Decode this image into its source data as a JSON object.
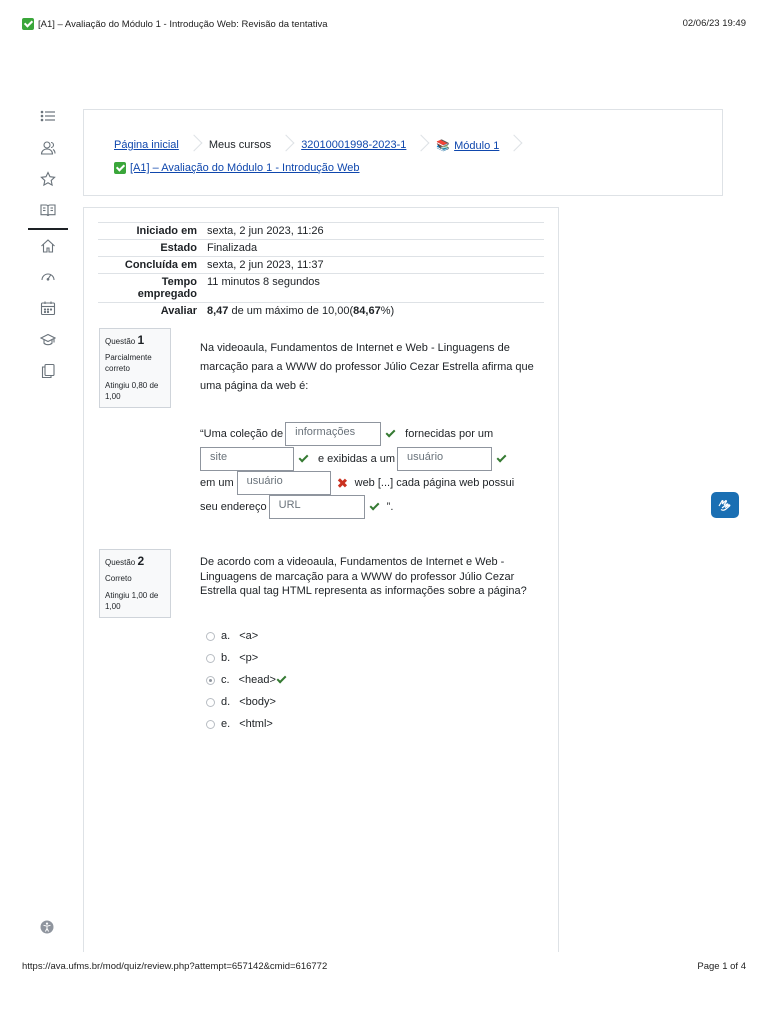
{
  "print_header": {
    "title": "[A1] – Avaliação do Módulo 1 - Introdução Web: Revisão da tentativa",
    "datetime": "02/06/23 19:49"
  },
  "print_footer": {
    "url": "https://ava.ufms.br/mod/quiz/review.php?attempt=657142&cmid=616772",
    "page": "Page 1 of 4"
  },
  "nav_rail": [
    "list-icon",
    "users-icon",
    "star-icon",
    "book-icon",
    "home-icon",
    "dashboard-icon",
    "calendar-icon",
    "graduation-cap-icon",
    "copy-icon"
  ],
  "breadcrumb": {
    "items": [
      "Página inicial",
      "Meus cursos",
      "32010001998-2023-1",
      "Módulo 1"
    ],
    "quiz_link": "[A1] – Avaliação do Módulo 1 - Introdução Web"
  },
  "summary": {
    "started_label": "Iniciado em",
    "started_value": "sexta, 2 jun 2023, 11:26",
    "state_label": "Estado",
    "state_value": "Finalizada",
    "completed_label": "Concluída em",
    "completed_value": "sexta, 2 jun 2023, 11:37",
    "time_label": "Tempo empregado",
    "time_value": "11 minutos 8 segundos",
    "grade_label": "Avaliar",
    "grade_score": "8,47",
    "grade_mid": " de um máximo de 10,00(",
    "grade_pct": "84,67",
    "grade_end": "%)"
  },
  "q1": {
    "label": "Questão",
    "number": "1",
    "state": "Parcialmente correto",
    "grade": "Atingiu 0,80 de 1,00",
    "text": "Na videoaula, Fundamentos de Internet e Web - Linguagens de marcação para a WWW do professor Júlio Cezar Estrella afirma que uma página da web é:",
    "cloze": {
      "t1": "“Uma coleção de",
      "a1": "informações",
      "t2": "fornecidas por um",
      "a2": "site",
      "t3": "e exibidas a um",
      "a3": "usuário",
      "t4": "em um",
      "a4": "usuário",
      "t5": "web [...] cada página web possui",
      "t6": "seu endereço",
      "a5": "URL",
      "t7": "”."
    }
  },
  "q2": {
    "label": "Questão",
    "number": "2",
    "state": "Correto",
    "grade": "Atingiu 1,00 de 1,00",
    "text": "De acordo com a videoaula, Fundamentos de Internet e Web - Linguagens de marcação para a WWW do professor Júlio Cezar Estrella qual tag HTML representa as informações sobre a página?",
    "options": [
      {
        "letter": "a.",
        "text": "<a>"
      },
      {
        "letter": "b.",
        "text": "<p>"
      },
      {
        "letter": "c.",
        "text": "<head>",
        "selected": true
      },
      {
        "letter": "d.",
        "text": "<body>"
      },
      {
        "letter": "e.",
        "text": "<html>"
      }
    ]
  },
  "colors": {
    "link": "#0f47ad",
    "correct": "#357a32",
    "incorrect": "#ca3120",
    "a11y": "#1a6fb3"
  }
}
